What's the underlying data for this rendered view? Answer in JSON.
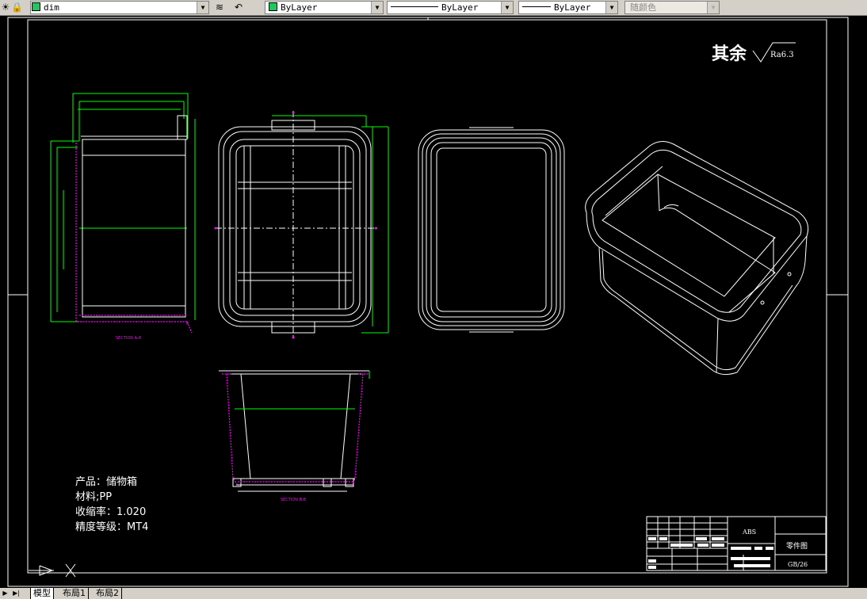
{
  "toolbar": {
    "layer_name": "dim",
    "color_value": "ByLayer",
    "linetype_value": "ByLayer",
    "lineweight_value": "ByLayer",
    "plotstyle_value": "随颜色"
  },
  "drawing": {
    "roughness_label": "其余",
    "roughness_value": "Ra6.3",
    "section_a_label": "SECTION A-A",
    "section_b_label": "SECTION B-B",
    "notes": [
      "产品：储物箱",
      "材料;PP",
      "收缩率：1.020",
      "精度等级：MT4"
    ],
    "title_block": {
      "material": "ABS",
      "drawing_name": "零件图",
      "code": "GB/26"
    }
  },
  "tabs": {
    "model": "模型",
    "layout1": "布局1",
    "layout2": "布局2"
  },
  "colors": {
    "accent_green": "#00ff00",
    "dimension_magenta": "#ff00ff",
    "line_white": "#ffffff",
    "toolbar_gray": "#d4d0c8"
  }
}
